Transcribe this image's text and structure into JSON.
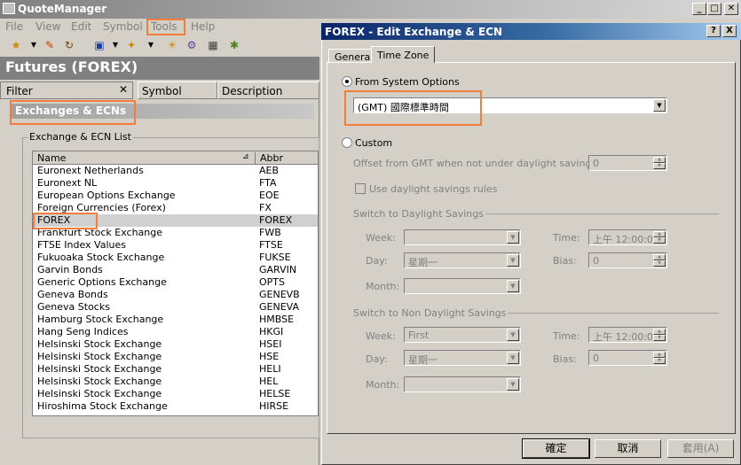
{
  "app": {
    "title": "QuoteManager",
    "menu": [
      "File",
      "View",
      "Edit",
      "Symbol",
      "Tools",
      "Help"
    ],
    "left_header": "Futures (FOREX)",
    "filter_label": "Filter",
    "filter_close": "✕",
    "columns": [
      "Symbol",
      "Description"
    ],
    "section_title": "Exchanges & ECNs",
    "group_label": "Exchange & ECN List",
    "list_headers": {
      "name": "Name",
      "abbr": "Abbr",
      "sort_glyph": "⊿"
    },
    "list_rows": [
      {
        "name": "Euronext Netherlands",
        "abbr": "AEB"
      },
      {
        "name": "Euronext NL",
        "abbr": "FTA"
      },
      {
        "name": "European Options Exchange",
        "abbr": "EOE"
      },
      {
        "name": "Foreign Currencies (Forex)",
        "abbr": "FX"
      },
      {
        "name": "FOREX",
        "abbr": "FOREX"
      },
      {
        "name": "Frankfurt Stock Exchange",
        "abbr": "FWB"
      },
      {
        "name": "FTSE Index Values",
        "abbr": "FTSE"
      },
      {
        "name": "Fukuoaka Stock Exchange",
        "abbr": "FUKSE"
      },
      {
        "name": "Garvin Bonds",
        "abbr": "GARVIN"
      },
      {
        "name": "Generic Options Exchange",
        "abbr": "OPTS"
      },
      {
        "name": "Geneva Bonds",
        "abbr": "GENEVB"
      },
      {
        "name": "Geneva Stocks",
        "abbr": "GENEVA"
      },
      {
        "name": "Hamburg Stock Exchange",
        "abbr": "HMBSE"
      },
      {
        "name": "Hang Seng Indices",
        "abbr": "HKGI"
      },
      {
        "name": "Helsinski Stock Exchange",
        "abbr": "HSEI"
      },
      {
        "name": "Helsinski Stock Exchange",
        "abbr": "HSE"
      },
      {
        "name": "Helsinski Stock Exchange",
        "abbr": "HELI"
      },
      {
        "name": "Helsinski Stock Exchange",
        "abbr": "HEL"
      },
      {
        "name": "Helsinski Stock Exchange",
        "abbr": "HELSE"
      },
      {
        "name": "Hiroshima Stock Exchange",
        "abbr": "HIRSE"
      }
    ],
    "selected_row": 4
  },
  "dialog": {
    "title": "FOREX - Edit Exchange & ECN",
    "help_btn": "?",
    "close_btn": "X",
    "tabs": [
      "General",
      "Time Zone"
    ],
    "from_system_label": "From System Options",
    "timezone_value": "(GMT) 國際標準時間",
    "custom_label": "Custom",
    "offset_label": "Offset from GMT when not under daylight savings:",
    "offset_value": "0",
    "use_dst_label": "Use daylight savings rules",
    "switch_to_dst": "Switch to Daylight Savings",
    "switch_to_non_dst": "Switch to Non Daylight Savings",
    "week_label": "Week:",
    "day_label": "Day:",
    "month_label": "Month:",
    "time_label": "Time:",
    "bias_label": "Bias:",
    "dst": {
      "week": "",
      "day": "星期一",
      "month": "",
      "time": "上午 12:00:0",
      "bias": "0"
    },
    "non_dst": {
      "week": "First",
      "day": "星期一",
      "month": "",
      "time": "上午 12:00:0",
      "bias": "0"
    },
    "ok": "確定",
    "cancel": "取消",
    "apply": "套用(A)"
  },
  "colors": {
    "highlight": "#f47c3c",
    "dialog_title": "#0a246a"
  }
}
